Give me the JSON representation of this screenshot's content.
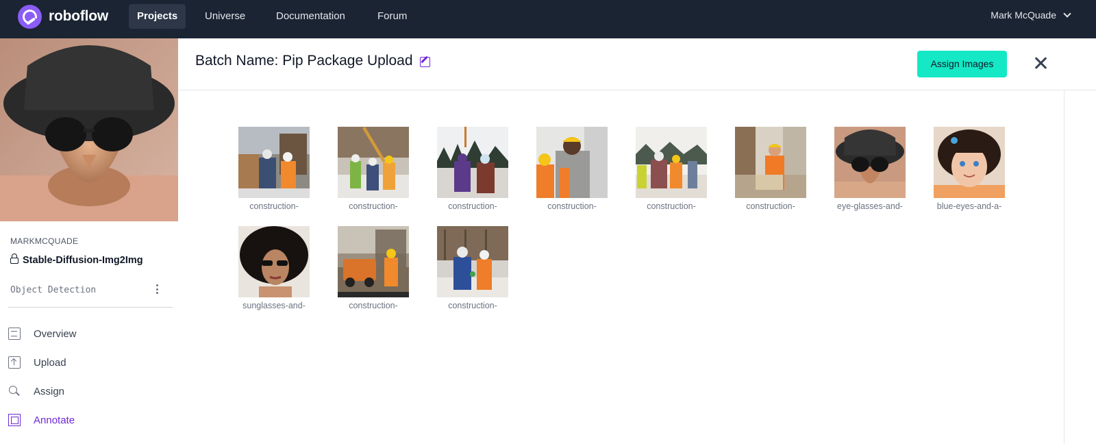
{
  "nav": {
    "brand": "roboflow",
    "items": [
      "Projects",
      "Universe",
      "Documentation",
      "Forum"
    ],
    "active": "Projects",
    "user": "Mark McQuade"
  },
  "sidebar": {
    "owner": "MARKMCQUADE",
    "project_name": "Stable-Diffusion-Img2Img",
    "project_type": "Object Detection",
    "items": [
      {
        "label": "Overview",
        "icon": "overview-icon"
      },
      {
        "label": "Upload",
        "icon": "upload-icon"
      },
      {
        "label": "Assign",
        "icon": "search-icon"
      },
      {
        "label": "Annotate",
        "icon": "annotate-icon"
      }
    ],
    "active": "Annotate"
  },
  "header": {
    "batch_title": "Batch Name: Pip Package Upload",
    "assign_button": "Assign Images"
  },
  "images": [
    {
      "label": "construction-"
    },
    {
      "label": "construction-"
    },
    {
      "label": "construction-"
    },
    {
      "label": "construction-"
    },
    {
      "label": "construction-"
    },
    {
      "label": "construction-"
    },
    {
      "label": "eye-glasses-and-"
    },
    {
      "label": "blue-eyes-and-a-"
    },
    {
      "label": "sunglasses-and-"
    },
    {
      "label": "construction-"
    },
    {
      "label": "construction-"
    }
  ],
  "colors": {
    "nav_bg": "#1b2433",
    "accent_purple": "#6d28d9",
    "assign_button_bg": "#15e8c5"
  }
}
